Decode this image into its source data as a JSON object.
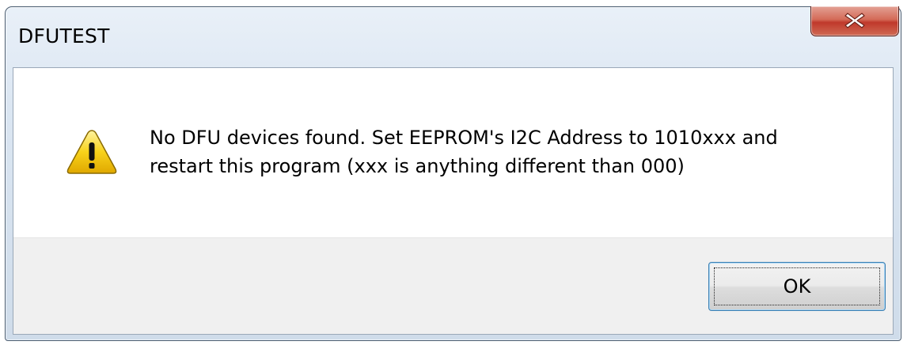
{
  "window": {
    "title": "DFUTEST"
  },
  "message": {
    "line1": "No DFU devices found. Set EEPROM's I2C Address to 1010xxx and",
    "line2": "restart this program (xxx is anything different than 000)"
  },
  "buttons": {
    "ok_label": "OK",
    "close_icon": "close-x-icon"
  },
  "icons": {
    "message_icon": "warning-icon"
  },
  "colors": {
    "close_button": "#c0392b",
    "warning_fill": "#f5c400",
    "button_area_bg": "#f0f0f0"
  }
}
